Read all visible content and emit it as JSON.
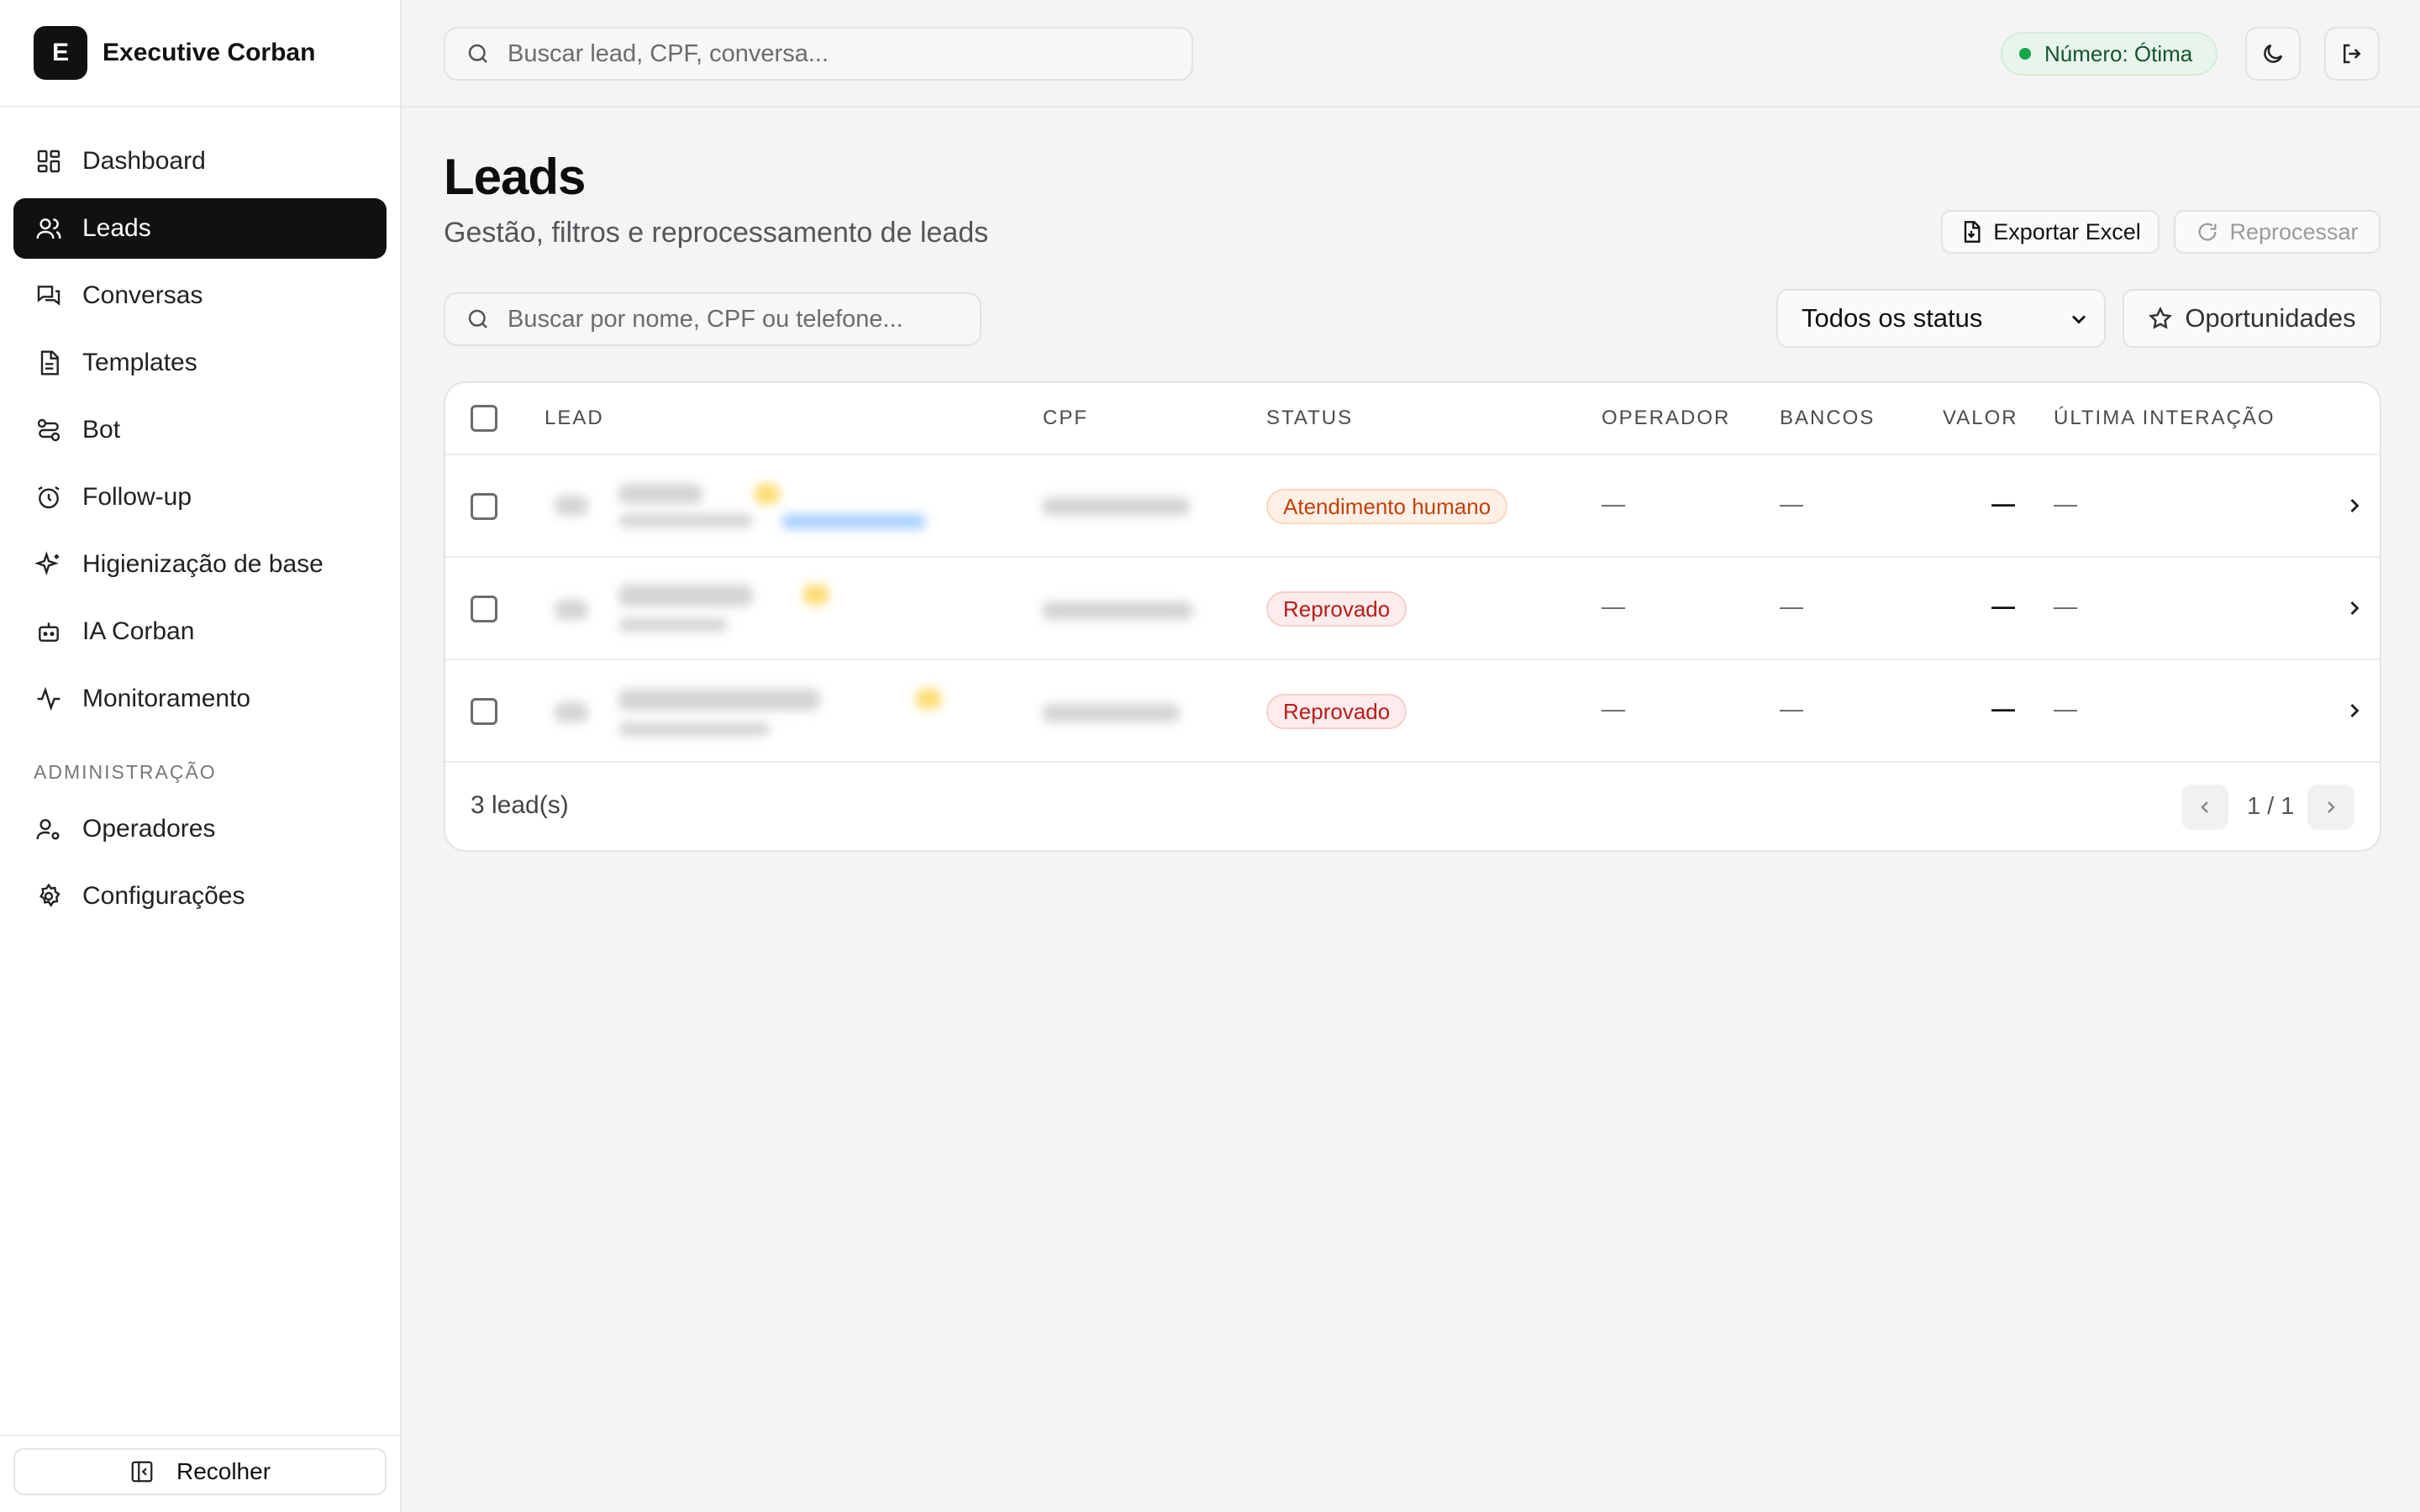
{
  "brand": {
    "logo_letter": "E",
    "name": "Executive Corban"
  },
  "sidebar": {
    "items": [
      {
        "label": "Dashboard",
        "icon": "dashboard-icon"
      },
      {
        "label": "Leads",
        "icon": "users-icon",
        "active": true
      },
      {
        "label": "Conversas",
        "icon": "chat-icon"
      },
      {
        "label": "Templates",
        "icon": "document-icon"
      },
      {
        "label": "Bot",
        "icon": "workflow-icon"
      },
      {
        "label": "Follow-up",
        "icon": "alarm-icon"
      },
      {
        "label": "Higienização de base",
        "icon": "sparkles-icon"
      },
      {
        "label": "IA Corban",
        "icon": "bot-icon"
      },
      {
        "label": "Monitoramento",
        "icon": "activity-icon"
      }
    ],
    "section_admin": "ADMINISTRAÇÃO",
    "admin_items": [
      {
        "label": "Operadores",
        "icon": "user-cog-icon"
      },
      {
        "label": "Configurações",
        "icon": "gear-icon"
      }
    ],
    "collapse_label": "Recolher"
  },
  "topbar": {
    "search_placeholder": "Buscar lead, CPF, conversa...",
    "status_label": "Número: Ótima",
    "status_color": "#16a34a"
  },
  "page": {
    "title": "Leads",
    "subtitle": "Gestão, filtros e reprocessamento de leads",
    "export_label": "Exportar Excel",
    "reprocess_label": "Reprocessar",
    "search_placeholder": "Buscar por nome, CPF ou telefone...",
    "status_filter": "Todos os status",
    "opportunities_label": "Oportunidades"
  },
  "table": {
    "headers": {
      "lead": "LEAD",
      "cpf": "CPF",
      "status": "STATUS",
      "operador": "OPERADOR",
      "bancos": "BANCOS",
      "valor": "VALOR",
      "ultima": "ÚLTIMA INTERAÇÃO"
    },
    "rows": [
      {
        "status": "Atendimento humano",
        "status_color": "#c2410c",
        "operador": "—",
        "bancos": "—",
        "valor": "—",
        "ultima": "—"
      },
      {
        "status": "Reprovado",
        "status_color": "#b91c1c",
        "operador": "—",
        "bancos": "—",
        "valor": "—",
        "ultima": "—"
      },
      {
        "status": "Reprovado",
        "status_color": "#b91c1c",
        "operador": "—",
        "bancos": "—",
        "valor": "—",
        "ultima": "—"
      }
    ],
    "count_label": "3 lead(s)",
    "pagination": "1 / 1"
  }
}
